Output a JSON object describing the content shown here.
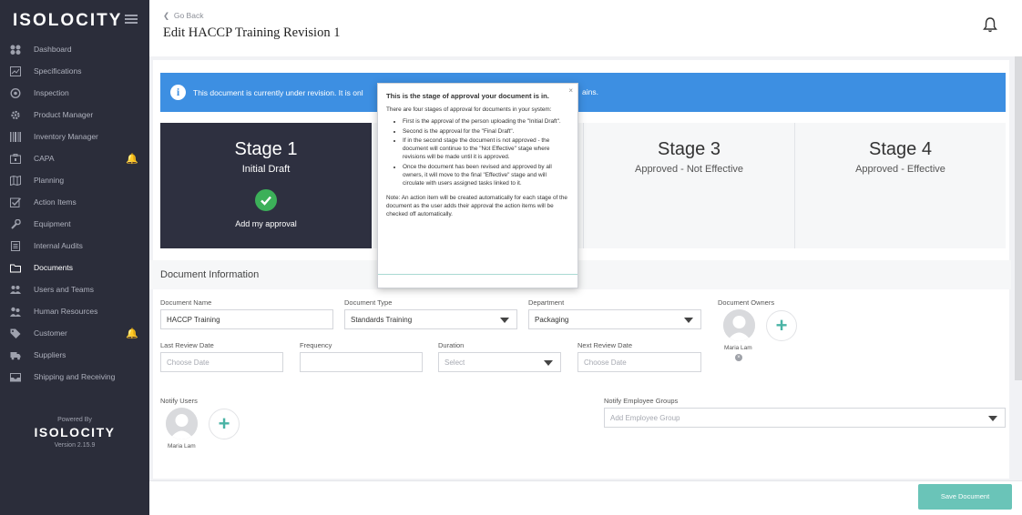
{
  "sidebar": {
    "logo": "ISOLOCITY",
    "items": [
      {
        "label": "Dashboard",
        "icon": "dashboard-icon",
        "alert": false
      },
      {
        "label": "Specifications",
        "icon": "specifications-icon",
        "alert": false
      },
      {
        "label": "Inspection",
        "icon": "inspection-icon",
        "alert": false
      },
      {
        "label": "Product Manager",
        "icon": "gear-icon",
        "alert": false
      },
      {
        "label": "Inventory Manager",
        "icon": "barcode-icon",
        "alert": false
      },
      {
        "label": "CAPA",
        "icon": "capa-icon",
        "alert": true
      },
      {
        "label": "Planning",
        "icon": "map-icon",
        "alert": false
      },
      {
        "label": "Action Items",
        "icon": "checkbox-icon",
        "alert": false
      },
      {
        "label": "Equipment",
        "icon": "wrench-icon",
        "alert": false
      },
      {
        "label": "Internal Audits",
        "icon": "document-icon",
        "alert": false
      },
      {
        "label": "Documents",
        "icon": "folder-icon",
        "alert": false,
        "active": true
      },
      {
        "label": "Users and Teams",
        "icon": "users-icon",
        "alert": false
      },
      {
        "label": "Human Resources",
        "icon": "human-resources-icon",
        "alert": false
      },
      {
        "label": "Customer",
        "icon": "tag-icon",
        "alert": true
      },
      {
        "label": "Suppliers",
        "icon": "truck-icon",
        "alert": false
      },
      {
        "label": "Shipping and Receiving",
        "icon": "inbox-icon",
        "alert": false
      }
    ],
    "powered_by": "Powered By",
    "powered_logo": "ISOLOCITY",
    "version": "Version 2.15.9"
  },
  "header": {
    "go_back": "Go Back",
    "title": "Edit HACCP Training Revision 1"
  },
  "banner": {
    "text": "This document is currently under revision. It is onl",
    "text_end": "ains."
  },
  "stages": [
    {
      "title": "Stage 1",
      "subtitle": "Initial Draft",
      "action": "Add my approval"
    },
    {
      "title": "Stage 3",
      "subtitle": "Approved - Not Effective"
    },
    {
      "title": "Stage 4",
      "subtitle": "Approved - Effective"
    }
  ],
  "popover": {
    "title": "This is the stage of approval your document is in.",
    "intro": "There are four stages of approval for documents in your system:",
    "bullets": [
      "First is the approval of the person uploading the \"Initial Draft\".",
      "Second is the approval for the \"Final Draft\".",
      "If in the second stage the document is not approved - the document will continue to the \"Not Effective\" stage where revisions will be made until it is approved.",
      "Once the document has been revised and approved by all owners, it will move to the final \"Effective\" stage and will circulate with users assigned tasks linked to it."
    ],
    "note": "Note: An action item will be created automatically for each stage of the document as the user adds their approval the action items will be checked off automatically.",
    "close": "×"
  },
  "doc_info": {
    "section_title": "Document Information",
    "name_label": "Document Name",
    "name_value": "HACCP Training",
    "type_label": "Document Type",
    "type_value": "Standards Training",
    "department_label": "Department",
    "department_value": "Packaging",
    "owners_label": "Document Owners",
    "owner_name": "Maria Lam",
    "last_review_label": "Last Review Date",
    "last_review_placeholder": "Choose Date",
    "frequency_label": "Frequency",
    "frequency_value": "",
    "duration_label": "Duration",
    "duration_placeholder": "Select",
    "next_review_label": "Next Review Date",
    "next_review_placeholder": "Choose Date",
    "notify_users_label": "Notify Users",
    "notify_user_name": "Maria Lam",
    "notify_groups_label": "Notify Employee Groups",
    "notify_groups_placeholder": "Add Employee Group"
  },
  "footer": {
    "save_label": "Save Document"
  },
  "colors": {
    "sidebar_bg": "#2b2d3a",
    "banner": "#3d8fe2",
    "stage_active": "#2e3040",
    "check": "#3cb059",
    "accent": "#4ab3a5",
    "save_button": "#6ac4b8",
    "alert": "#e0564f"
  }
}
